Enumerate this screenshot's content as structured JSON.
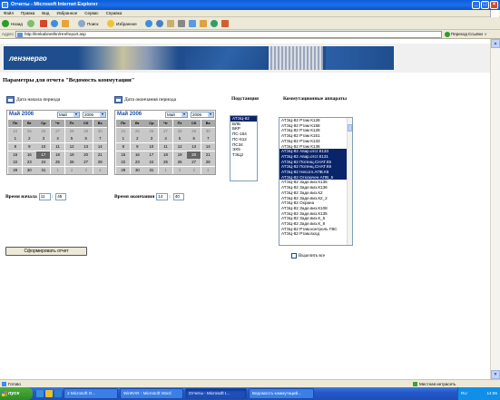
{
  "window": {
    "title": "Отчеты - Microsoft Internet Explorer"
  },
  "menu": [
    "Файл",
    "Правка",
    "Вид",
    "Избранное",
    "Сервис",
    "Справка"
  ],
  "toolbar": {
    "back": "Назад",
    "search": "Поиск",
    "favorites": "Избранное"
  },
  "address": {
    "label": "Адрес:",
    "url": "http://lenkabinet/kn/Hrefreport.asp",
    "go": "Переход",
    "links": "Ссылки"
  },
  "banner": {
    "logo_text": "ленэнерго"
  },
  "page": {
    "title": "Параметры для отчета \"Ведомость коммутации\""
  },
  "start_period": {
    "label": "Дата начала периода",
    "calendar": {
      "month_title": "Май 2006",
      "month_select": "Май",
      "year_select": "2006",
      "weekdays": [
        "Пн",
        "Вт",
        "Ср",
        "Чт",
        "Пт",
        "Сб",
        "Вс"
      ],
      "rows": [
        [
          "24",
          "25",
          "26",
          "27",
          "28",
          "29",
          "30"
        ],
        [
          "1",
          "2",
          "3",
          "4",
          "5",
          "6",
          "7"
        ],
        [
          "8",
          "9",
          "10",
          "11",
          "12",
          "13",
          "14"
        ],
        [
          "15",
          "16",
          "17",
          "18",
          "19",
          "20",
          "21"
        ],
        [
          "22",
          "23",
          "24",
          "25",
          "26",
          "27",
          "28"
        ],
        [
          "29",
          "30",
          "31",
          "1",
          "2",
          "3",
          "4"
        ]
      ],
      "selected_day": "17"
    }
  },
  "end_period": {
    "label": "Дата окончания периода",
    "calendar": {
      "month_title": "Май 2006",
      "month_select": "Май",
      "year_select": "2006",
      "weekdays": [
        "Пн",
        "Вт",
        "Ср",
        "Чт",
        "Пт",
        "Сб",
        "Вс"
      ],
      "rows": [
        [
          "24",
          "25",
          "26",
          "27",
          "28",
          "29",
          "30"
        ],
        [
          "1",
          "2",
          "3",
          "4",
          "5",
          "6",
          "7"
        ],
        [
          "8",
          "9",
          "10",
          "11",
          "12",
          "13",
          "14"
        ],
        [
          "15",
          "16",
          "17",
          "18",
          "19",
          "20",
          "21"
        ],
        [
          "22",
          "23",
          "24",
          "25",
          "26",
          "27",
          "28"
        ],
        [
          "29",
          "30",
          "31",
          "1",
          "2",
          "3",
          "4"
        ]
      ],
      "selected_day": "20"
    }
  },
  "substations": {
    "label": "Подстанция",
    "items": [
      "АТЭЦ-82",
      "ВЛБ",
      "БКР",
      "ПС-154",
      "ПС-512",
      "ПС34",
      "ЭХ5",
      "ТЭЦ2"
    ],
    "selected_index": 0
  },
  "apparatus": {
    "label": "Коммутационные аппараты",
    "items": [
      "АТЭЦ-82 Ртам К128",
      "АТЭЦ-82 Ртам К158",
      "АТЭЦ-82 Ртам К128",
      "АТЭЦ-82 Ртам К151",
      "АТЭЦ-82 Ртам К133",
      "АТЭЦ-82 Ртам К138",
      "АТЭЦ-82 Авар.отст.К133",
      "АТЭЦ-82 Авар.отст.К131",
      "АТЭЦ-82 Потенц.СНАТ.К5",
      "АТЭЦ-82 Потенц.СНАТ.К6",
      "АТЭЦ-82 Несогл.АПВ.К6",
      "АТЭЦ-82 Отключен АПВ_5",
      "АТЭЦ-82 Заде.виз.К135",
      "АТЭЦ-82 Заде.виз.К136",
      "АТЭЦ-82 Заде.виз.К2",
      "АТЭЦ-82 Заде.виз.К2_2",
      "АТЭЦ-82 Охрана",
      "АТЭЦ-82 Заде.виз.К108",
      "АТЭЦ-82 Заде.виз.К135",
      "АТЭЦ-82 Заде.виз.К_5",
      "АТЭЦ-82 Заде.виз.К_8",
      "АТЭЦ-82 Ртам.контроль ГВС",
      "АТЭЦ-82 Ртам.вход"
    ],
    "selected_indices": [
      6,
      7,
      8,
      9,
      10,
      11
    ]
  },
  "time_start": {
    "label": "Время начала",
    "hours": "11",
    "minutes": "45"
  },
  "time_end": {
    "label": "Время окончания",
    "hours": "14",
    "minutes": "40"
  },
  "select_all": {
    "label": "Выделить все",
    "checked": false
  },
  "form_button": {
    "label": "Сформировать отчет"
  },
  "status": {
    "text": "Готово",
    "zone": "Местная интрасеть"
  },
  "taskbar": {
    "start": "пуск",
    "tasks": [
      "2 Microsoft O...",
      "WinRAR - Microsoft Word",
      "Отчеты - Microsoft I...",
      "Ведомость коммутаций..."
    ],
    "active_index": 2,
    "lang": "RU",
    "clock": "14:55"
  }
}
